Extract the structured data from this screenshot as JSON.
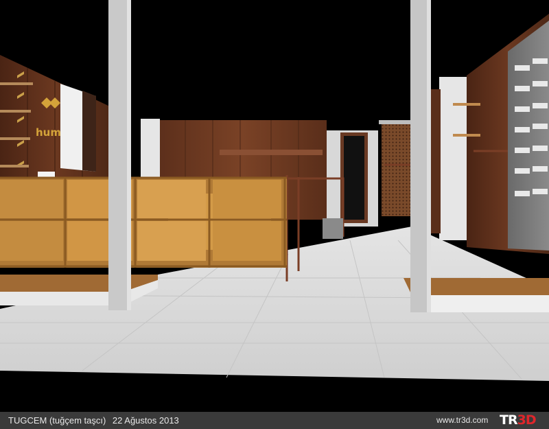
{
  "scene": {
    "brand_sign": "hummel",
    "colors": {
      "floor": "#d6d6d6",
      "wood_dark": "#5a2e1a",
      "wood_light": "#c8903e",
      "pillar": "#c9c9c9",
      "background": "#000000"
    }
  },
  "footer": {
    "author": "TUGCEM (tuğçem taşcı)",
    "date": "22 Ağustos 2013",
    "url": "www.tr3d.com",
    "logo_tr": "TR",
    "logo_3d": "3D"
  }
}
